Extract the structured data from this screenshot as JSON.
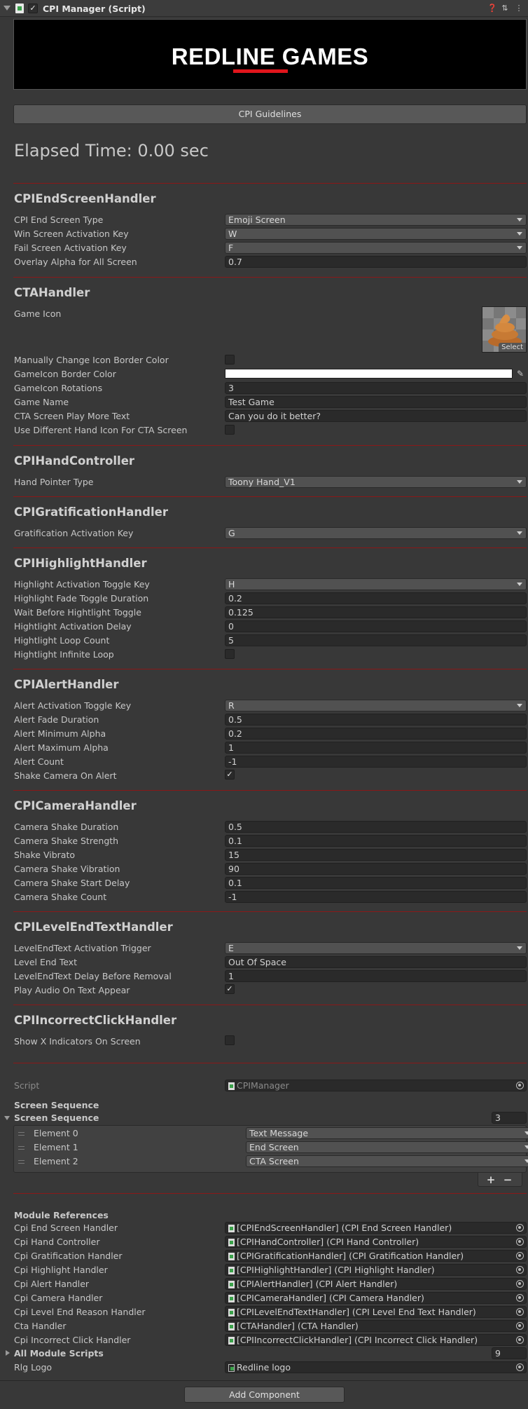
{
  "header": {
    "title": "CPI Manager (Script)",
    "checked": true
  },
  "banner": {
    "logo_text": "REDLINE GAMES"
  },
  "guidelines_button": "CPI Guidelines",
  "elapsed_time": "Elapsed Time: 0.00 sec",
  "end_screen": {
    "title": "CPIEndScreenHandler",
    "type_label": "CPI End Screen Type",
    "type_value": "Emoji Screen",
    "win_label": "Win Screen Activation Key",
    "win_value": "W",
    "fail_label": "Fail Screen Activation Key",
    "fail_value": "F",
    "alpha_label": "Overlay Alpha for All Screen",
    "alpha_value": "0.7"
  },
  "cta": {
    "title": "CTAHandler",
    "icon_label": "Game Icon",
    "icon_select": "Select",
    "manual_border_label": "Manually Change Icon Border Color",
    "manual_border_checked": false,
    "border_color_label": "GameIcon Border Color",
    "border_color": "#ffffff",
    "rotations_label": "GameIcon Rotations",
    "rotations_value": "3",
    "game_name_label": "Game Name",
    "game_name_value": "Test Game",
    "play_more_label": "CTA Screen Play More Text",
    "play_more_value": "Can you do it better?",
    "diff_hand_label": "Use Different Hand Icon For CTA Screen",
    "diff_hand_checked": false
  },
  "hand": {
    "title": "CPIHandController",
    "pointer_label": "Hand Pointer Type",
    "pointer_value": "Toony Hand_V1"
  },
  "gratification": {
    "title": "CPIGratificationHandler",
    "key_label": "Gratification Activation Key",
    "key_value": "G"
  },
  "highlight": {
    "title": "CPIHighlightHandler",
    "toggle_label": "Highlight Activation Toggle Key",
    "toggle_value": "H",
    "fade_label": "Highlight Fade Toggle Duration",
    "fade_value": "0.2",
    "wait_label": "Wait Before Hightlight Toggle",
    "wait_value": "0.125",
    "delay_label": "Hightlight Activation Delay",
    "delay_value": "0",
    "loop_label": "Hightlight Loop Count",
    "loop_value": "5",
    "infinite_label": "Hightlight Infinite Loop",
    "infinite_checked": false
  },
  "alert": {
    "title": "CPIAlertHandler",
    "toggle_label": "Alert Activation Toggle Key",
    "toggle_value": "R",
    "fade_label": "Alert Fade Duration",
    "fade_value": "0.5",
    "min_label": "Alert Minimum Alpha",
    "min_value": "0.2",
    "max_label": "Alert Maximum Alpha",
    "max_value": "1",
    "count_label": "Alert Count",
    "count_value": "-1",
    "shake_label": "Shake Camera On Alert",
    "shake_checked": true
  },
  "camera": {
    "title": "CPICameraHandler",
    "duration_label": "Camera Shake Duration",
    "duration_value": "0.5",
    "strength_label": "Camera Shake Strength",
    "strength_value": "0.1",
    "vibrato_label": "Shake Vibrato",
    "vibrato_value": "15",
    "vibration_label": "Camera Shake Vibration",
    "vibration_value": "90",
    "start_delay_label": "Camera Shake Start Delay",
    "start_delay_value": "0.1",
    "count_label": "Camera Shake Count",
    "count_value": "-1"
  },
  "level_end": {
    "title": "CPILevelEndTextHandler",
    "trigger_label": "LevelEndText Activation Trigger",
    "trigger_value": "E",
    "text_label": "Level End Text",
    "text_value": "Out Of Space",
    "delay_label": "LevelEndText Delay Before Removal",
    "delay_value": "1",
    "audio_label": "Play Audio On Text Appear",
    "audio_checked": true
  },
  "incorrect": {
    "title": "CPIIncorrectClickHandler",
    "show_label": "Show X Indicators On Screen",
    "show_checked": false
  },
  "script": {
    "label": "Script",
    "value": "CPIManager"
  },
  "screen_sequence": {
    "header": "Screen Sequence",
    "foldout": "Screen Sequence",
    "size": "3",
    "elements": [
      {
        "label": "Element 0",
        "value": "Text Message"
      },
      {
        "label": "Element 1",
        "value": "End Screen"
      },
      {
        "label": "Element 2",
        "value": "CTA Screen"
      }
    ],
    "plus": "+",
    "minus": "−"
  },
  "modules": {
    "header": "Module References",
    "items": [
      {
        "label": "Cpi End Screen Handler",
        "value": "[CPIEndScreenHandler] (CPI End Screen Handler)"
      },
      {
        "label": "Cpi Hand Controller",
        "value": "[CPIHandController] (CPI Hand Controller)"
      },
      {
        "label": "Cpi Gratification Handler",
        "value": "[CPIGratificationHandler] (CPI Gratification Handler)"
      },
      {
        "label": "Cpi Highlight Handler",
        "value": "[CPIHighlightHandler] (CPI Highlight Handler)"
      },
      {
        "label": "Cpi Alert Handler",
        "value": "[CPIAlertHandler] (CPI Alert Handler)"
      },
      {
        "label": "Cpi Camera Handler",
        "value": "[CPICameraHandler] (CPI Camera Handler)"
      },
      {
        "label": "Cpi Level End Reason Handler",
        "value": "[CPILevelEndTextHandler] (CPI Level End Text Handler)"
      },
      {
        "label": "Cta Handler",
        "value": "[CTAHandler] (CTA Handler)"
      },
      {
        "label": "Cpi Incorrect Click Handler",
        "value": "[CPIIncorrectClickHandler] (CPI Incorrect Click Handler)"
      }
    ],
    "all_scripts_label": "All Module Scripts",
    "all_scripts_count": "9",
    "logo_label": "Rlg Logo",
    "logo_value": "Redline logo"
  },
  "add_component": "Add Component",
  "colors": {
    "accent_line": "#8a1818",
    "background": "#383838",
    "field": "#2a2a2a"
  }
}
